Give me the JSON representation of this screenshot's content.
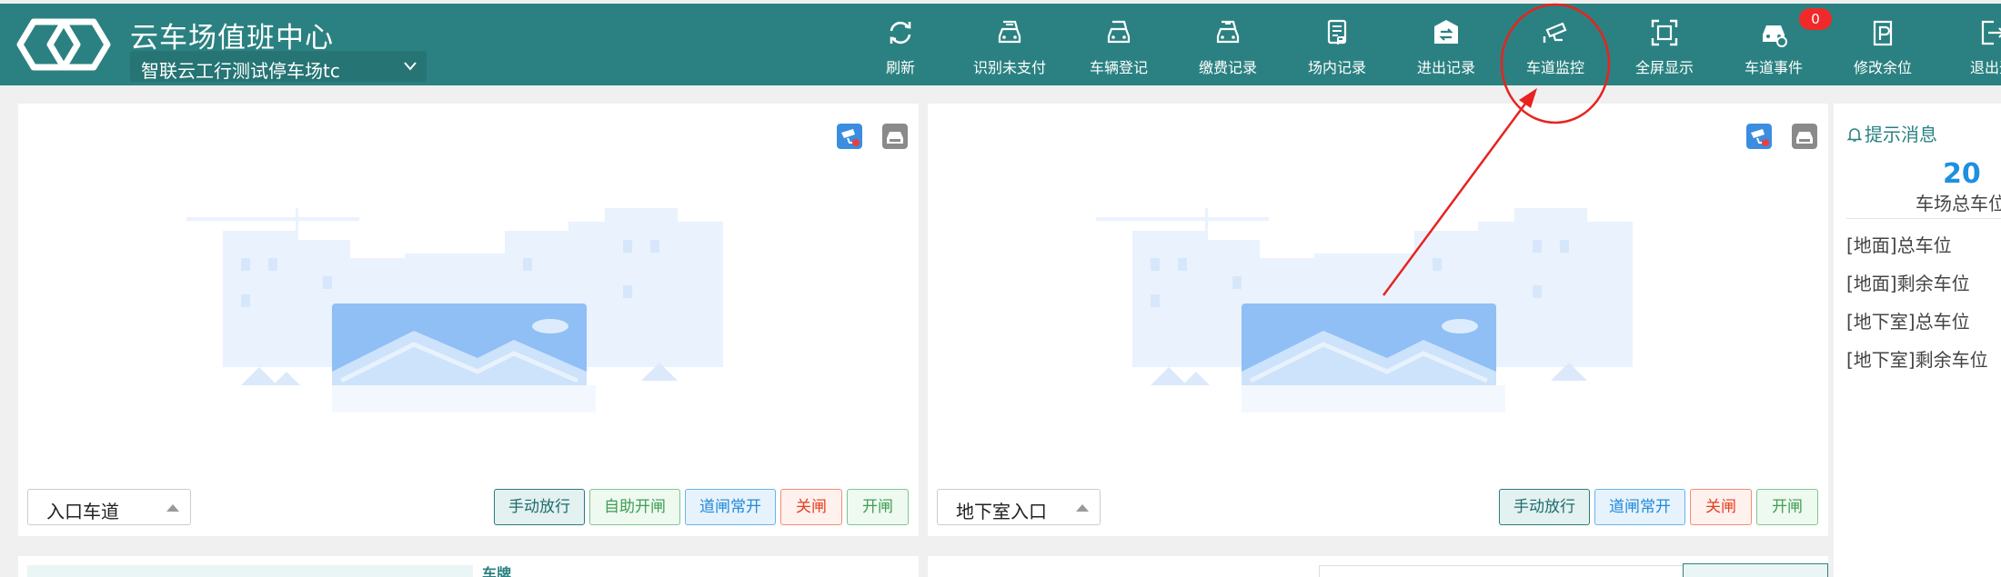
{
  "header": {
    "title": "云车场值班中心",
    "parking_lot": "智联云工行测试停车场tc"
  },
  "toolbar": [
    {
      "label": "刷新",
      "icon": "refresh-icon"
    },
    {
      "label": "识别未支付",
      "icon": "unpaid-car-icon"
    },
    {
      "label": "车辆登记",
      "icon": "register-car-icon"
    },
    {
      "label": "缴费记录",
      "icon": "payment-car-icon"
    },
    {
      "label": "场内记录",
      "icon": "document-icon"
    },
    {
      "label": "进出记录",
      "icon": "entry-exit-icon"
    },
    {
      "label": "车道监控",
      "icon": "camera-icon"
    },
    {
      "label": "全屏显示",
      "icon": "fullscreen-icon"
    },
    {
      "label": "车道事件",
      "icon": "car-event-icon",
      "badge": "0"
    },
    {
      "label": "修改余位",
      "icon": "edit-parking-icon"
    },
    {
      "label": "退出登",
      "icon": "logout-icon"
    }
  ],
  "lanes": [
    {
      "selected": "入口车道",
      "buttons": [
        "手动放行",
        "自助开闸",
        "道闸常开",
        "关闸",
        "开闸"
      ]
    },
    {
      "selected": "地下室入口",
      "buttons": [
        "手动放行",
        "道闸常开",
        "关闸",
        "开闸"
      ]
    }
  ],
  "info": {
    "hint": "提示消息",
    "total_count": "20",
    "total_label": "车场总车位",
    "rows": [
      "[地面]总车位",
      "[地面]剩余车位",
      "[地下室]总车位",
      "[地下室]剩余车位"
    ]
  },
  "bottom": {
    "plate_label": "车牌"
  },
  "colors": {
    "header": "#2b8181",
    "accent_blue": "#1e90e0",
    "annotation_red": "#e8231f"
  }
}
